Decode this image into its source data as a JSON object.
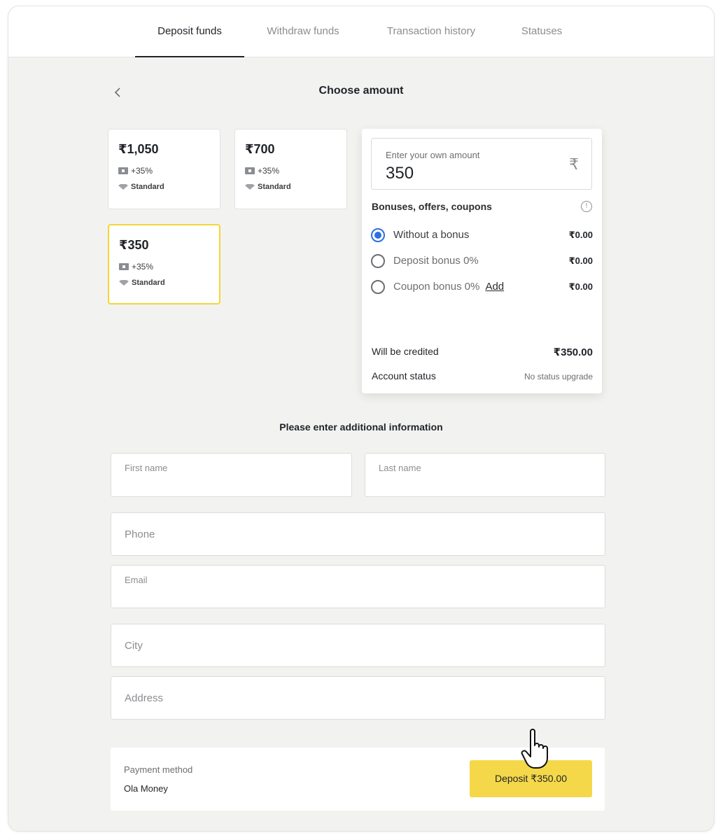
{
  "tabs": [
    {
      "label": "Deposit funds",
      "active": true
    },
    {
      "label": "Withdraw funds",
      "active": false
    },
    {
      "label": "Transaction history",
      "active": false
    },
    {
      "label": "Statuses",
      "active": false
    }
  ],
  "header": {
    "title": "Choose amount"
  },
  "amount_cards": [
    {
      "amount": "₹1,050",
      "bonus": "+35%",
      "tier": "Standard",
      "selected": false
    },
    {
      "amount": "₹700",
      "bonus": "+35%",
      "tier": "Standard",
      "selected": false
    },
    {
      "amount": "₹350",
      "bonus": "+35%",
      "tier": "Standard",
      "selected": true
    }
  ],
  "own_amount": {
    "label": "Enter your own amount",
    "value": "350",
    "currency_symbol": "₹"
  },
  "bonuses": {
    "heading": "Bonuses, offers, coupons",
    "info_symbol": "!",
    "options": [
      {
        "label": "Without a bonus",
        "value": "₹0.00",
        "selected": true
      },
      {
        "label": "Deposit bonus 0%",
        "value": "₹0.00",
        "selected": false
      },
      {
        "label": "Coupon bonus 0%",
        "value": "₹0.00",
        "selected": false,
        "link": "Add"
      }
    ]
  },
  "summary": {
    "credited_label": "Will be credited",
    "credited_value": "₹350.00",
    "status_label": "Account status",
    "status_value": "No status upgrade"
  },
  "form": {
    "title": "Please enter additional information",
    "first_name_placeholder": "First name",
    "last_name_placeholder": "Last name",
    "phone_placeholder": "Phone",
    "email_placeholder": "Email",
    "city_placeholder": "City",
    "address_placeholder": "Address"
  },
  "payment": {
    "label": "Payment method",
    "method": "Ola Money",
    "button_label": "Deposit ₹350.00"
  },
  "colors": {
    "accent_yellow": "#f5d84a",
    "selected_border": "#f5d535",
    "radio_blue": "#2c6fe0"
  }
}
